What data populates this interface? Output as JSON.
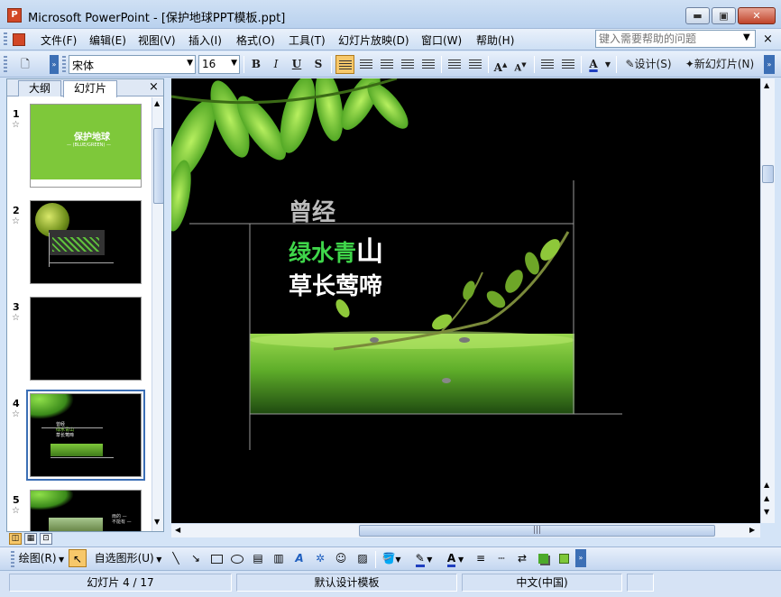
{
  "window": {
    "app_icon": "powerpoint-icon",
    "title": "Microsoft PowerPoint - [保护地球PPT模板.ppt]",
    "minimize_icon": "minimize-icon",
    "maximize_icon": "maximize-icon",
    "close_icon": "close-icon"
  },
  "menu": {
    "items": [
      "文件(F)",
      "编辑(E)",
      "视图(V)",
      "插入(I)",
      "格式(O)",
      "工具(T)",
      "幻灯片放映(D)",
      "窗口(W)",
      "帮助(H)"
    ],
    "help_placeholder": "键入需要帮助的问题",
    "close_doc": "×"
  },
  "format_toolbar": {
    "font_name": "宋体",
    "font_size": "16",
    "bold": "B",
    "italic": "I",
    "underline": "U",
    "shadow": "S",
    "grow_font": "A",
    "shrink_font": "A",
    "font_color": "A",
    "design_button": "设计(S)",
    "new_slide_button": "新幻灯片(N)"
  },
  "left_pane": {
    "tabs": [
      "大纲",
      "幻灯片"
    ],
    "close": "×",
    "slides": [
      {
        "num": "1",
        "title": "保护地球",
        "subtitle": "— (BLUE/GREEN) —",
        "selected": false
      },
      {
        "num": "2",
        "selected": false
      },
      {
        "num": "3",
        "selected": false
      },
      {
        "num": "4",
        "text_lines": [
          "曾经",
          "绿水青山",
          "草长莺啼"
        ],
        "selected": true
      },
      {
        "num": "5",
        "text_lines": [
          "雨的 —",
          "不能有 —"
        ],
        "selected": false
      }
    ]
  },
  "slide": {
    "line1": "曾经",
    "line2_green": "绿水青",
    "line2_white": "山",
    "line3": "草长莺啼"
  },
  "draw_toolbar": {
    "draw_menu": "绘图(R)",
    "autoshapes_menu": "自选图形(U)"
  },
  "status": {
    "slide_info": "幻灯片 4 / 17",
    "template": "默认设计模板",
    "language": "中文(中国)"
  },
  "colors": {
    "title_bar": "#cfe0f4",
    "slide_bg": "#000000",
    "thumb1_bg": "#7ec83a",
    "accent_active": "#f7c86a",
    "selected_outline": "#3c6fb5"
  }
}
